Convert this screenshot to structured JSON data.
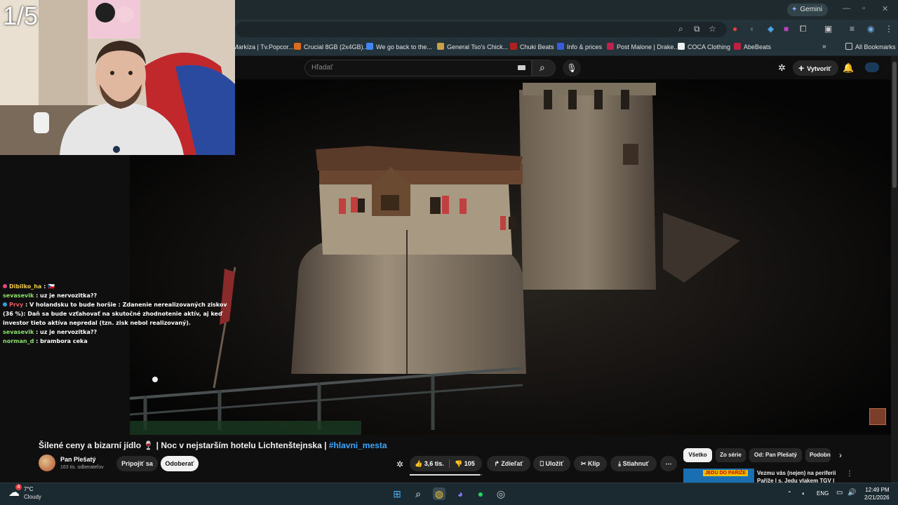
{
  "browser": {
    "gemini_label": "Gemini",
    "bookmarks": [
      {
        "label": "Markíza | Tv.Popcor...",
        "color": "#e0564a"
      },
      {
        "label": "Crucial 8GB (2x4GB)...",
        "color": "#e06a1a"
      },
      {
        "label": "We go back to the...",
        "color": "#4285f4"
      },
      {
        "label": "General Tso's Chick...",
        "color": "#c9a04a"
      },
      {
        "label": "Chuki Beats",
        "color": "#b02020"
      },
      {
        "label": "Info & prices",
        "color": "#3b5bdb"
      },
      {
        "label": "Post Malone | Drake...",
        "color": "#c02050"
      },
      {
        "label": "COCA Clothing",
        "color": "#f0f0f0"
      },
      {
        "label": "AbeBeats",
        "color": "#c02040"
      }
    ],
    "all_bookmarks": "All Bookmarks"
  },
  "youtube": {
    "search_placeholder": "Hľadať",
    "create_label": "Vytvoriť"
  },
  "stream": {
    "counter": "1/5",
    "chat": [
      {
        "user": "Dibilko_ha",
        "text": " : 🇨🇿",
        "color": "yellow",
        "badge": "#e04a7a"
      },
      {
        "user": "sevasevik",
        "text": " : uz je nervozitka??",
        "color": "green",
        "badge": ""
      },
      {
        "user": "Prvy",
        "text": " : V holandsku to bude horšie : Zdanenie nerealizovaných ziskov (36 %): Daň sa bude vzťahovať na skutočné zhodnotenie aktív, aj keď investor tieto aktíva nepredal (tzn. zisk nebol realizovaný).",
        "color": "red",
        "badge": "#3a9ae0"
      },
      {
        "user": "sevasevik",
        "text": " : uz je nervozitka??",
        "color": "green",
        "badge": ""
      },
      {
        "user": "norman_d",
        "text": " : brambora ceka",
        "color": "green",
        "badge": ""
      }
    ]
  },
  "video": {
    "title": "Šilené ceny a bizarní jídlo 🍷 | Noc v nejstarším hotelu Lichtenštejnska | ",
    "hashtag": "#hlavni_mesta",
    "channel": "Pan Plešatý",
    "subscribers": "163 tis. odberateľov",
    "join_label": "Pripojiť sa",
    "subscribe_label": "Odoberať",
    "likes": "3,6 tis.",
    "dislikes": "105",
    "share_label": "Zdieľať",
    "save_label": "Uložiť",
    "clip_label": "Klip",
    "download_label": "Stiahnuť",
    "like_ratio": 0.97
  },
  "sidebar": {
    "chips": [
      "Všetko",
      "Zo série",
      "Od: Pan Plešatý",
      "Podobné"
    ],
    "rec_thumb_text": "JEDU DO PAŘÍŽE",
    "rec_title": "Vezmu vás (nejen) na periferii Paříže | s. Jedu vlakem TGV |"
  },
  "taskbar": {
    "temp": "7°C",
    "weather": "Cloudy",
    "lang": "ENG",
    "time": "12:49 PM",
    "date": "2/21/2026",
    "notification_count": "4"
  }
}
